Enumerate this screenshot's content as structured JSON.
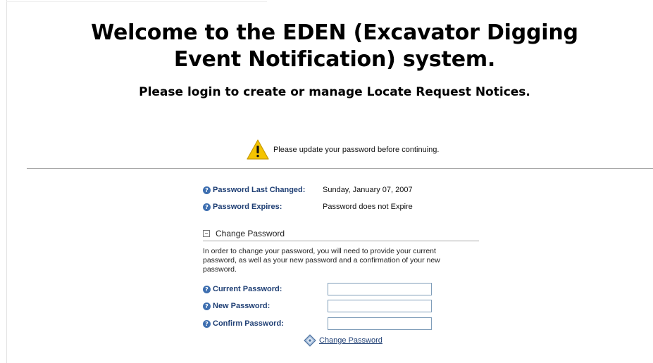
{
  "header": {
    "title": "Welcome to the EDEN (Excavator Digging Event Notification) system.",
    "subtitle": "Please login to create or manage Locate Request Notices."
  },
  "notice": {
    "icon": "warning-icon",
    "message": "Please update your password before continuing."
  },
  "info": [
    {
      "label": "Password Last Changed:",
      "value": "Sunday, January 07, 2007",
      "icon": "help-icon"
    },
    {
      "label": "Password Expires:",
      "value": "Password does not Expire",
      "icon": "help-icon"
    }
  ],
  "change_password": {
    "section_title": "Change Password",
    "collapse_icon": "collapse-icon",
    "instructions": "In order to change your password, you will need to provide your current password, as well as your new password and a confirmation of your new password.",
    "fields": [
      {
        "label": "Current Password:",
        "value": ""
      },
      {
        "label": "New Password:",
        "value": ""
      },
      {
        "label": "Confirm Password:",
        "value": ""
      }
    ],
    "submit_label": "Change Password",
    "submit_icon": "key-diamond-icon"
  },
  "colors": {
    "label_blue": "#1f3f74",
    "help_icon_blue": "#3e6fb0",
    "warning_yellow": "#f5c400",
    "input_border": "#7f9db9"
  }
}
